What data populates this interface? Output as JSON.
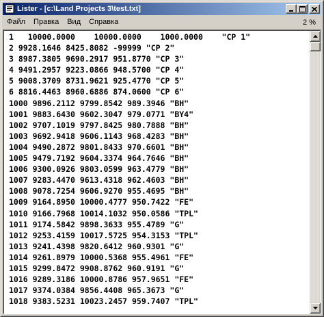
{
  "window": {
    "title": "Lister - [c:\\Land Projects 3\\test.txt]",
    "app_icon": "lister-app-icon",
    "buttons": {
      "minimize_icon": "minimize-icon",
      "maximize_icon": "maximize-icon",
      "close_icon": "close-icon"
    }
  },
  "menu": {
    "items": [
      {
        "label": "Файл"
      },
      {
        "label": "Правка"
      },
      {
        "label": "Вид"
      },
      {
        "label": "Справка"
      }
    ],
    "zoom": "2 %"
  },
  "scrollbar": {
    "up_icon": "scroll-up-arrow-icon",
    "down_icon": "scroll-down-arrow-icon",
    "position_percent": 2
  },
  "file_lines": [
    "1   10000.0000    10000.0000    1000.0000    \"CP 1\"",
    "2 9928.1646 8425.8082 -99999 \"CP 2\"",
    "3 8987.3805 9690.2917 951.8770 \"CP 3\"",
    "4 9491.2957 9223.0866 948.5700 \"CP 4\"",
    "5 9008.3709 8731.9621 925.4770 \"CP 5\"",
    "6 8816.4463 8960.6886 874.0600 \"CP 6\"",
    "1000 9896.2112 9799.8542 989.3946 \"BH\"",
    "1001 9883.6430 9602.3047 979.0771 \"BY4\"",
    "1002 9707.1019 9797.8425 980.7888 \"BH\"",
    "1003 9692.9418 9606.1143 968.4283 \"BH\"",
    "1004 9490.2872 9801.8433 970.6601 \"BH\"",
    "1005 9479.7192 9604.3374 964.7646 \"BH\"",
    "1006 9300.0926 9803.0599 963.4779 \"BH\"",
    "1007 9283.4470 9613.4318 962.4603 \"BH\"",
    "1008 9078.7254 9606.9270 955.4695 \"BH\"",
    "1009 9164.8950 10000.4777 950.7422 \"FE\"",
    "1010 9166.7968 10014.1032 950.0586 \"TPL\"",
    "1011 9174.5842 9898.3633 955.4789 \"G\"",
    "1012 9253.4159 10017.5725 954.3153 \"TPL\"",
    "1013 9241.4398 9820.6412 960.9301 \"G\"",
    "1014 9261.8979 10000.5368 955.4961 \"FE\"",
    "1015 9299.8472 9908.8762 960.9191 \"G\"",
    "1016 9289.3186 10000.8786 957.9651 \"FE\"",
    "1017 9374.0384 9856.4408 965.3673 \"G\"",
    "1018 9383.5231 10023.2457 959.7407 \"TPL\""
  ]
}
